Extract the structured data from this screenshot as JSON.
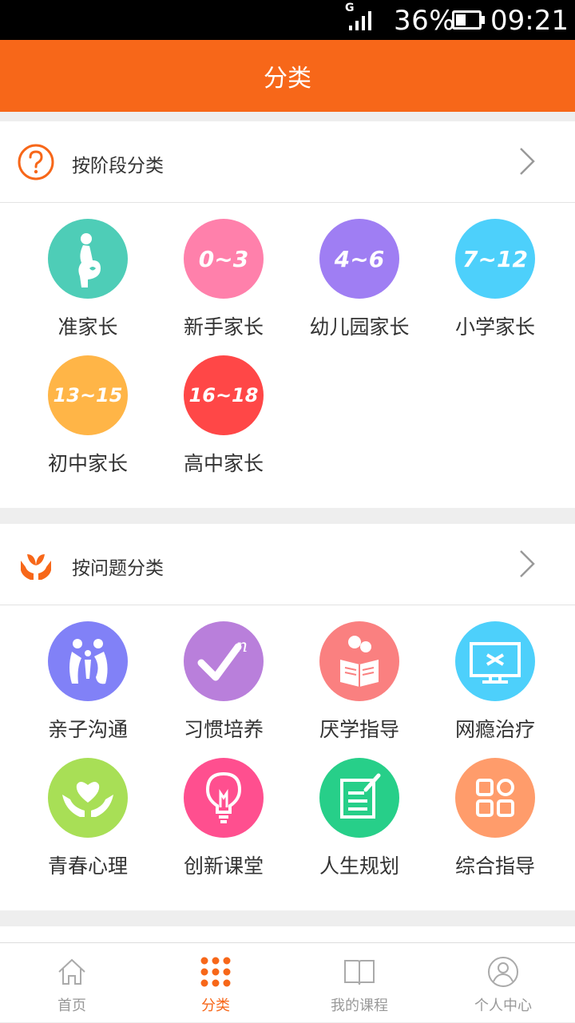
{
  "status_bar": {
    "network": "G",
    "battery_percent": "36%",
    "time": "09:21"
  },
  "app_bar": {
    "title": "分类"
  },
  "stage_section": {
    "title": "按阶段分类",
    "items": [
      {
        "label": "准家长",
        "badge": "",
        "color": "#4ecdb7",
        "icon": "pregnant-icon"
      },
      {
        "label": "新手家长",
        "badge": "0~3",
        "color": "#ff80ab"
      },
      {
        "label": "幼儿园家长",
        "badge": "4~6",
        "color": "#9f7ef3"
      },
      {
        "label": "小学家长",
        "badge": "7~12",
        "color": "#4dd0fb"
      },
      {
        "label": "初中家长",
        "badge": "13~15",
        "color": "#ffb547"
      },
      {
        "label": "高中家长",
        "badge": "16~18",
        "color": "#ff4747"
      }
    ]
  },
  "problem_section": {
    "title": "按问题分类",
    "items": [
      {
        "label": "亲子沟通",
        "color": "#8181f7",
        "icon": "family-icon"
      },
      {
        "label": "习惯培养",
        "color": "#b97fdb",
        "icon": "checkmark-icon"
      },
      {
        "label": "厌学指导",
        "color": "#fa8080",
        "icon": "reading-icon"
      },
      {
        "label": "网瘾治疗",
        "color": "#4dd0fb",
        "icon": "monitor-icon"
      },
      {
        "label": "青春心理",
        "color": "#a8df56",
        "icon": "heart-hands-icon"
      },
      {
        "label": "创新课堂",
        "color": "#ff4f8f",
        "icon": "lightbulb-icon"
      },
      {
        "label": "人生规划",
        "color": "#27cf89",
        "icon": "notepad-icon"
      },
      {
        "label": "综合指导",
        "color": "#ff9c6b",
        "icon": "grid-icon"
      }
    ]
  },
  "tab_bar": {
    "tabs": [
      {
        "label": "首页",
        "icon": "home-icon",
        "active": false
      },
      {
        "label": "分类",
        "icon": "dots-grid-icon",
        "active": true
      },
      {
        "label": "我的课程",
        "icon": "book-icon",
        "active": false
      },
      {
        "label": "个人中心",
        "icon": "user-icon",
        "active": false
      }
    ]
  },
  "colors": {
    "accent": "#f76719",
    "text": "#333333",
    "tab_inactive": "#999999"
  }
}
